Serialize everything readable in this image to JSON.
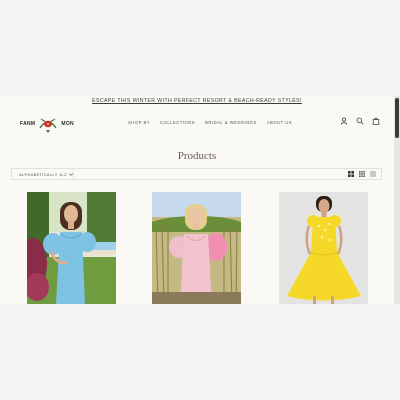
{
  "announcement": "ESCAPE THIS WINTER WITH PERFECT RESORT & BEACH-READY STYLES!",
  "brand": {
    "left_word": "FANM",
    "right_word": "MON"
  },
  "nav": [
    {
      "label": "SHOP BY",
      "has_dropdown": true
    },
    {
      "label": "COLLECTIONS",
      "has_dropdown": true
    },
    {
      "label": "BRIDAL & WEDDINGS",
      "has_dropdown": true
    },
    {
      "label": "ABOUT US",
      "has_dropdown": true
    }
  ],
  "header_icons": [
    "account-icon",
    "search-icon",
    "cart-icon"
  ],
  "page_title": "Products",
  "toolbar": {
    "sort_label": "ALPHABETICALLY, A-Z",
    "view_options": [
      "grid-large-view-icon",
      "grid-small-view-icon",
      "list-view-icon"
    ]
  },
  "products": [
    {
      "image": "woman in light blue dress with puff sleeves in a garden",
      "color": "#7ec3e4"
    },
    {
      "image": "woman in pink dress with puff sleeves in a field",
      "color": "#f2c4cf"
    },
    {
      "image": "woman in yellow embroidered midi dress",
      "color": "#f6d928"
    }
  ],
  "colors": {
    "page_bg": "#f4f4f2",
    "site_bg": "#faf9f6",
    "title": "#6b5a52",
    "text": "#3a3a3a"
  }
}
